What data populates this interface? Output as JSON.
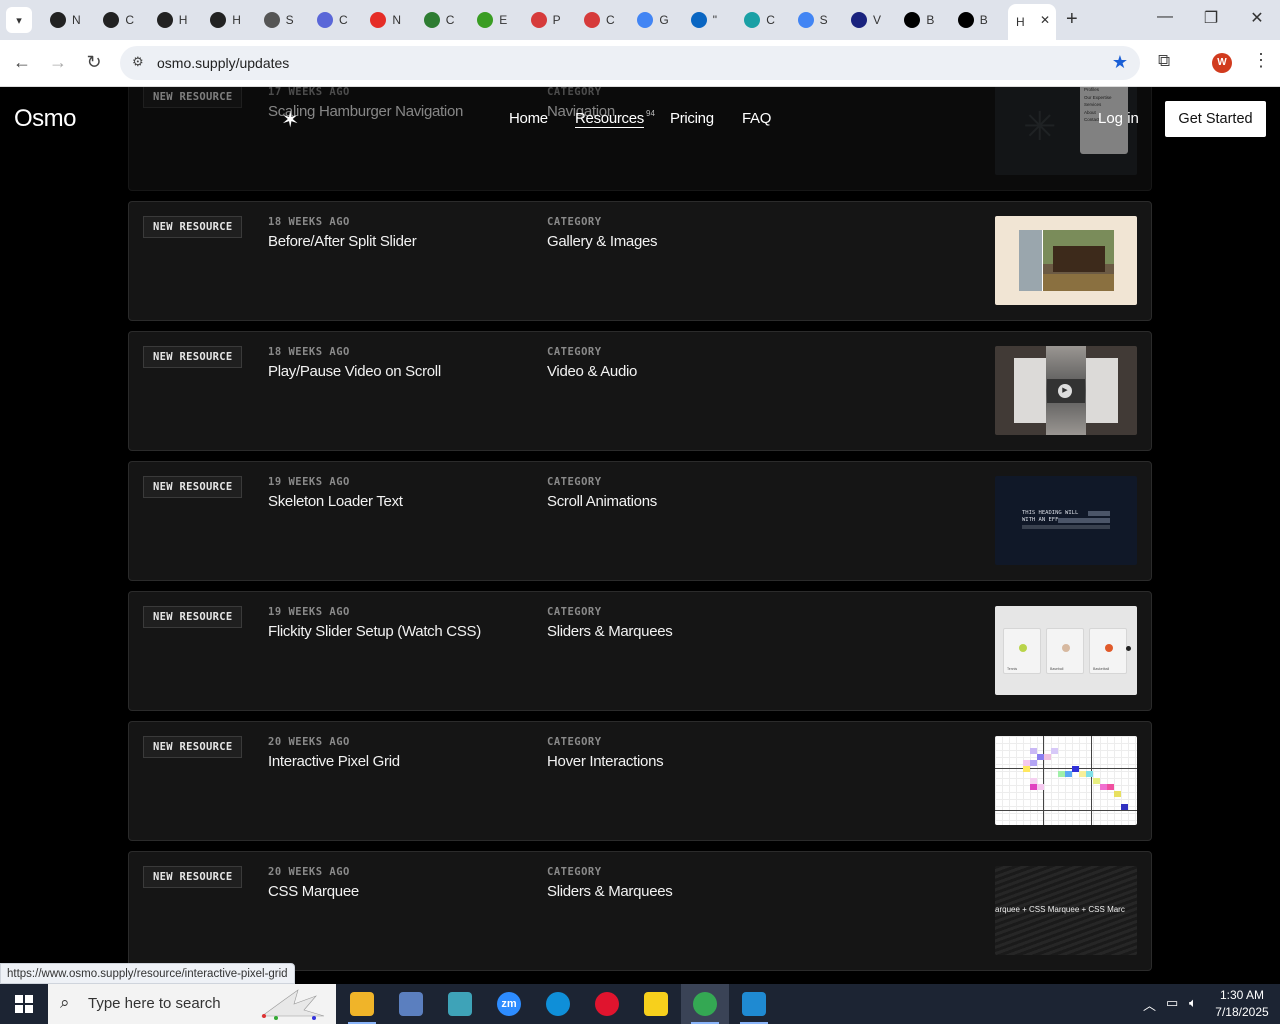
{
  "browser": {
    "tabs": [
      {
        "letter": "N",
        "icon": "openai-icon",
        "color": "#222"
      },
      {
        "letter": "C",
        "icon": "openai-icon",
        "color": "#222"
      },
      {
        "letter": "H",
        "icon": "openai-icon",
        "color": "#222"
      },
      {
        "letter": "H",
        "icon": "openai-icon",
        "color": "#222"
      },
      {
        "letter": "S",
        "icon": "wordpress-icon",
        "color": "#555"
      },
      {
        "letter": "C",
        "icon": "claude-icon",
        "color": "#5a67d8"
      },
      {
        "letter": "N",
        "icon": "youtube-icon",
        "color": "#e52d27"
      },
      {
        "letter": "C",
        "icon": "webflow-icon",
        "color": "#2e7d32"
      },
      {
        "letter": "E",
        "icon": "elementor-icon",
        "color": "#3a9d23"
      },
      {
        "letter": "P",
        "icon": "diamond-icon",
        "color": "#d63b3b"
      },
      {
        "letter": "C",
        "icon": "diamond-icon",
        "color": "#d63b3b"
      },
      {
        "letter": "G",
        "icon": "google-icon",
        "color": "#4285f4"
      },
      {
        "letter": "\"",
        "icon": "linkedin-icon",
        "color": "#0a66c2"
      },
      {
        "letter": "C",
        "icon": "hexagon-icon",
        "color": "#1aa0a5"
      },
      {
        "letter": "S",
        "icon": "google-icon",
        "color": "#4285f4"
      },
      {
        "letter": "V",
        "icon": "x-tool-icon",
        "color": "#1a237e"
      },
      {
        "letter": "B",
        "icon": "x-icon",
        "color": "#000"
      },
      {
        "letter": "B",
        "icon": "x-icon",
        "color": "#000"
      }
    ],
    "active_tab_letter": "H",
    "url": "osmo.supply/updates",
    "status_url": "https://www.osmo.supply/resource/interactive-pixel-grid",
    "profile_initial": "W"
  },
  "site": {
    "logo": "Osmo",
    "nav": {
      "home": "Home",
      "resources": "Resources",
      "resources_count": "94",
      "pricing": "Pricing",
      "faq": "FAQ"
    },
    "login": "Log in",
    "cta": "Get Started"
  },
  "cards": [
    {
      "badge": "NEW RESOURCE",
      "age": "17 WEEKS AGO",
      "title": "Scaling Hamburger Navigation",
      "cat_label": "CATEGORY",
      "category": "Navigation",
      "thumb": "hamburger"
    },
    {
      "badge": "NEW RESOURCE",
      "age": "18 WEEKS AGO",
      "title": "Before/After Split Slider",
      "cat_label": "CATEGORY",
      "category": "Gallery & Images",
      "thumb": "split"
    },
    {
      "badge": "NEW RESOURCE",
      "age": "18 WEEKS AGO",
      "title": "Play/Pause Video on Scroll",
      "cat_label": "CATEGORY",
      "category": "Video & Audio",
      "thumb": "video"
    },
    {
      "badge": "NEW RESOURCE",
      "age": "19 WEEKS AGO",
      "title": "Skeleton Loader Text",
      "cat_label": "CATEGORY",
      "category": "Scroll Animations",
      "thumb": "skeleton"
    },
    {
      "badge": "NEW RESOURCE",
      "age": "19 WEEKS AGO",
      "title": "Flickity Slider Setup (Watch CSS)",
      "cat_label": "CATEGORY",
      "category": "Sliders & Marquees",
      "thumb": "flickity"
    },
    {
      "badge": "NEW RESOURCE",
      "age": "20 WEEKS AGO",
      "title": "Interactive Pixel Grid",
      "cat_label": "CATEGORY",
      "category": "Hover Interactions",
      "thumb": "pixel"
    },
    {
      "badge": "NEW RESOURCE",
      "age": "20 WEEKS AGO",
      "title": "CSS Marquee",
      "cat_label": "CATEGORY",
      "category": "Sliders & Marquees",
      "thumb": "marquee"
    }
  ],
  "thumb_text": {
    "hamburger_menu": [
      "Profiles",
      "Our Expertise",
      "Services",
      "About",
      "Contact"
    ],
    "skeleton_heading": "THIS HEADING WILL",
    "skeleton_heading2": "WITH AN EFF",
    "flickity_items": [
      "Tennis",
      "Baseball",
      "Basketball"
    ],
    "marquee_text": "arquee  +  CSS Marquee  +  CSS Marc"
  },
  "taskbar": {
    "search_placeholder": "Type here to search",
    "apps": [
      {
        "name": "file-explorer-icon",
        "color": "#f0b429",
        "label": ""
      },
      {
        "name": "paint-icon",
        "color": "#5b7fbf",
        "label": ""
      },
      {
        "name": "hexagon-app-icon",
        "color": "#3ea3b8",
        "label": ""
      },
      {
        "name": "zoom-icon",
        "color": "#2d8cff",
        "label": "zm"
      },
      {
        "name": "edge-icon",
        "color": "#0f8fd8",
        "label": ""
      },
      {
        "name": "opera-icon",
        "color": "#e0142e",
        "label": ""
      },
      {
        "name": "sticky-notes-icon",
        "color": "#f7d01c",
        "label": ""
      },
      {
        "name": "chrome-icon",
        "color": "#34a853",
        "label": ""
      },
      {
        "name": "vscode-icon",
        "color": "#1f8ad2",
        "label": ""
      }
    ],
    "time": "1:30 AM",
    "date": "7/18/2025"
  }
}
